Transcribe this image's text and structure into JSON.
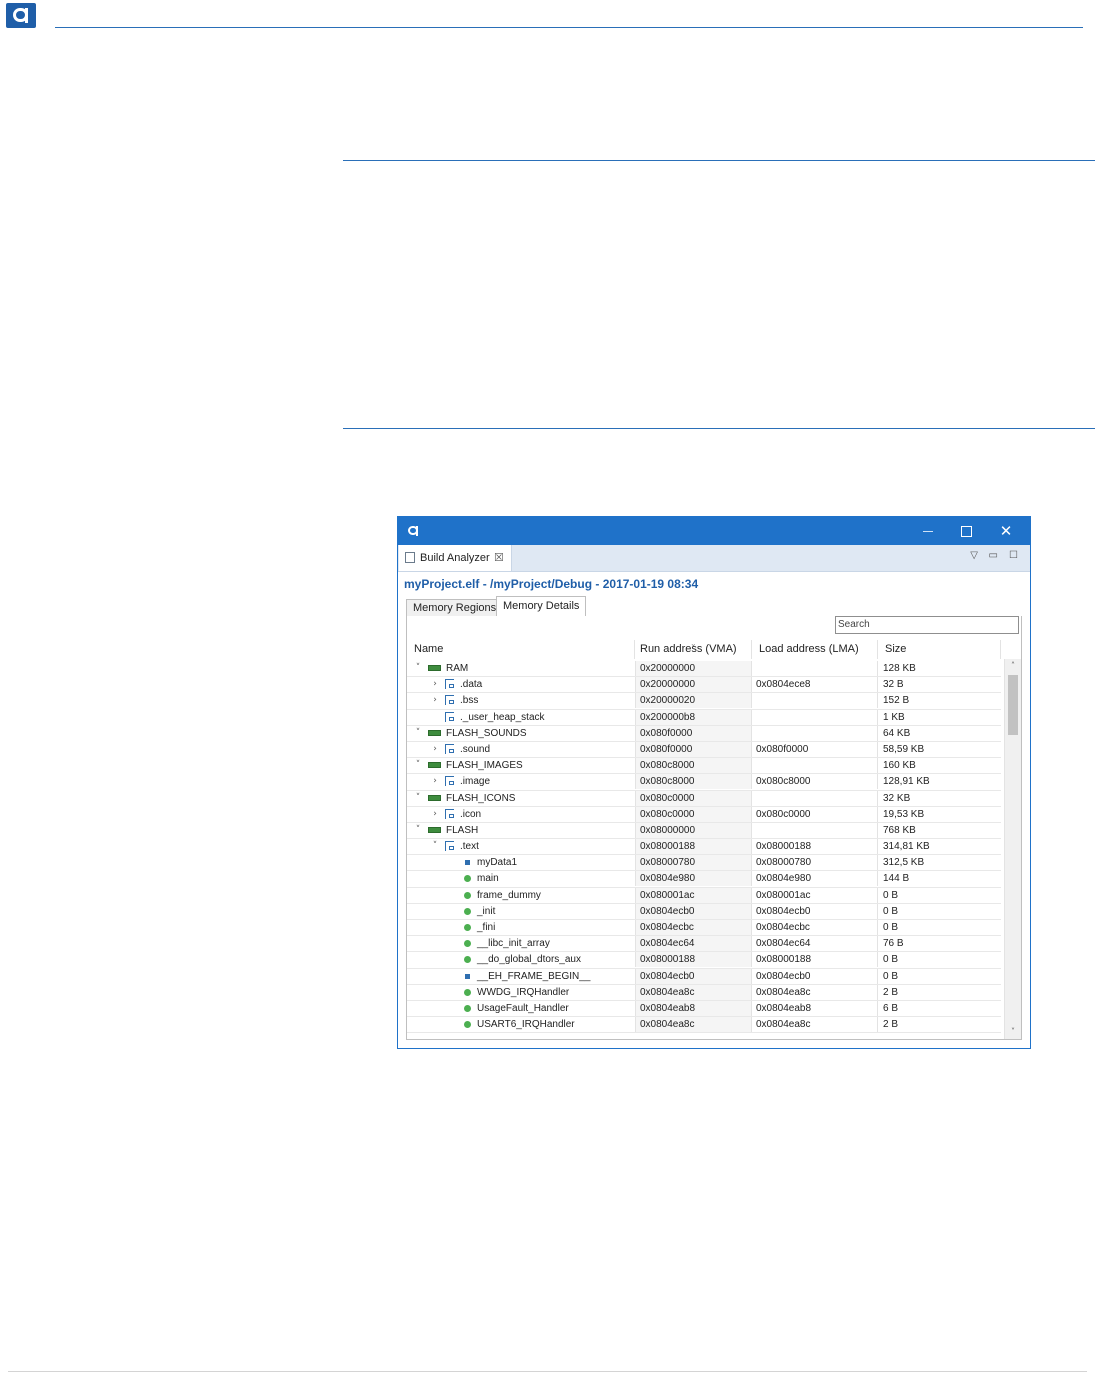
{
  "window": {
    "title_controls": {
      "minimize": "—",
      "maximize": "☐",
      "close": "✕"
    },
    "view_tab": {
      "label": "Build Analyzer",
      "close": "☒"
    },
    "view_controls": {
      "menu": "▽",
      "minimize": "▭",
      "maximize": "☐"
    },
    "heading": "myProject.elf - /myProject/Debug - 2017-01-19 08:34",
    "tabs": [
      "Memory Regions",
      "Memory Details"
    ],
    "active_tab": "Memory Details",
    "search_placeholder": "Search",
    "columns": {
      "name": "Name",
      "run": "Run address (VMA)",
      "load": "Load address (LMA)",
      "size": "Size"
    },
    "rows": [
      {
        "level": 0,
        "expander": "open",
        "icon": "memory-region-icon",
        "name": "RAM",
        "run": "0x20000000",
        "load": "",
        "size": "128 KB"
      },
      {
        "level": 1,
        "expander": "closed",
        "icon": "section-icon",
        "name": ".data",
        "run": "0x20000000",
        "load": "0x0804ece8",
        "size": "32 B"
      },
      {
        "level": 1,
        "expander": "closed",
        "icon": "section-icon",
        "name": ".bss",
        "run": "0x20000020",
        "load": "",
        "size": "152 B"
      },
      {
        "level": 1,
        "expander": "none",
        "icon": "section-icon",
        "name": "._user_heap_stack",
        "run": "0x200000b8",
        "load": "",
        "size": "1 KB"
      },
      {
        "level": 0,
        "expander": "open",
        "icon": "memory-region-icon",
        "name": "FLASH_SOUNDS",
        "run": "0x080f0000",
        "load": "",
        "size": "64 KB"
      },
      {
        "level": 1,
        "expander": "closed",
        "icon": "section-icon",
        "name": ".sound",
        "run": "0x080f0000",
        "load": "0x080f0000",
        "size": "58,59 KB"
      },
      {
        "level": 0,
        "expander": "open",
        "icon": "memory-region-icon",
        "name": "FLASH_IMAGES",
        "run": "0x080c8000",
        "load": "",
        "size": "160 KB"
      },
      {
        "level": 1,
        "expander": "closed",
        "icon": "section-icon",
        "name": ".image",
        "run": "0x080c8000",
        "load": "0x080c8000",
        "size": "128,91 KB"
      },
      {
        "level": 0,
        "expander": "open",
        "icon": "memory-region-icon",
        "name": "FLASH_ICONS",
        "run": "0x080c0000",
        "load": "",
        "size": "32 KB"
      },
      {
        "level": 1,
        "expander": "closed",
        "icon": "section-icon",
        "name": ".icon",
        "run": "0x080c0000",
        "load": "0x080c0000",
        "size": "19,53 KB"
      },
      {
        "level": 0,
        "expander": "open",
        "icon": "memory-region-icon",
        "name": "FLASH",
        "run": "0x08000000",
        "load": "",
        "size": "768 KB"
      },
      {
        "level": 1,
        "expander": "open",
        "icon": "section-icon",
        "name": ".text",
        "run": "0x08000188",
        "load": "0x08000188",
        "size": "314,81 KB"
      },
      {
        "level": 2,
        "expander": "none",
        "icon": "variable-icon",
        "name": "myData1",
        "run": "0x08000780",
        "load": "0x08000780",
        "size": "312,5 KB"
      },
      {
        "level": 2,
        "expander": "none",
        "icon": "function-icon",
        "name": "main",
        "run": "0x0804e980",
        "load": "0x0804e980",
        "size": "144 B"
      },
      {
        "level": 2,
        "expander": "none",
        "icon": "function-icon",
        "name": "frame_dummy",
        "run": "0x080001ac",
        "load": "0x080001ac",
        "size": "0 B"
      },
      {
        "level": 2,
        "expander": "none",
        "icon": "function-icon",
        "name": "_init",
        "run": "0x0804ecb0",
        "load": "0x0804ecb0",
        "size": "0 B"
      },
      {
        "level": 2,
        "expander": "none",
        "icon": "function-icon",
        "name": "_fini",
        "run": "0x0804ecbc",
        "load": "0x0804ecbc",
        "size": "0 B"
      },
      {
        "level": 2,
        "expander": "none",
        "icon": "function-icon",
        "name": "__libc_init_array",
        "run": "0x0804ec64",
        "load": "0x0804ec64",
        "size": "76 B"
      },
      {
        "level": 2,
        "expander": "none",
        "icon": "function-icon",
        "name": "__do_global_dtors_aux",
        "run": "0x08000188",
        "load": "0x08000188",
        "size": "0 B"
      },
      {
        "level": 2,
        "expander": "none",
        "icon": "variable-icon",
        "name": "__EH_FRAME_BEGIN__",
        "run": "0x0804ecb0",
        "load": "0x0804ecb0",
        "size": "0 B"
      },
      {
        "level": 2,
        "expander": "none",
        "icon": "function-icon",
        "name": "WWDG_IRQHandler",
        "run": "0x0804ea8c",
        "load": "0x0804ea8c",
        "size": "2 B"
      },
      {
        "level": 2,
        "expander": "none",
        "icon": "function-icon",
        "name": "UsageFault_Handler",
        "run": "0x0804eab8",
        "load": "0x0804eab8",
        "size": "6 B"
      },
      {
        "level": 2,
        "expander": "none",
        "icon": "function-icon",
        "name": "USART6_IRQHandler",
        "run": "0x0804ea8c",
        "load": "0x0804ea8c",
        "size": "2 B"
      }
    ],
    "scrollbar": {
      "up": "˄",
      "down": "˅"
    }
  },
  "colors": {
    "brand": "#1f5ea8",
    "titlebar": "#1f72c9",
    "rule": "#2a6fb8"
  }
}
